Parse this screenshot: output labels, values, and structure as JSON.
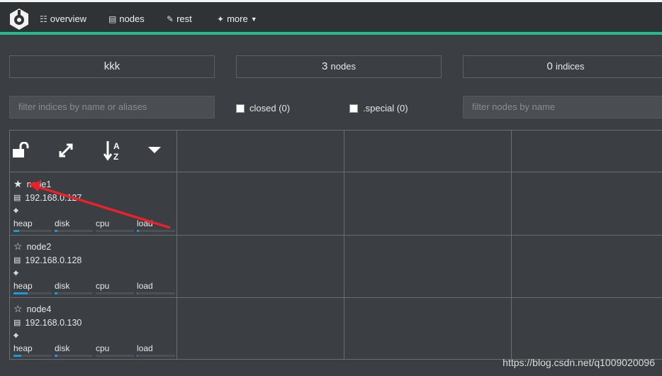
{
  "nav": {
    "overview": "overview",
    "nodes": "nodes",
    "rest": "rest",
    "more": "more"
  },
  "summary": {
    "cluster_name": "kkk",
    "nodes_count": "3",
    "nodes_label": "nodes",
    "indices_count": "0",
    "indices_label": "indices"
  },
  "filters": {
    "indices_placeholder": "filter indices by name or aliases",
    "closed": "closed (0)",
    "special": ".special (0)",
    "nodes_placeholder": "filter nodes by name"
  },
  "stat_labels": [
    "heap",
    "disk",
    "cpu",
    "load"
  ],
  "nodes": [
    {
      "name": "node1",
      "ip": "192.168.0.127",
      "master": true,
      "heap": 14,
      "disk": 7,
      "cpu": 0,
      "load": 5
    },
    {
      "name": "node2",
      "ip": "192.168.0.128",
      "master": false,
      "heap": 37,
      "disk": 7,
      "cpu": 0,
      "load": 1
    },
    {
      "name": "node4",
      "ip": "192.168.0.130",
      "master": false,
      "heap": 20,
      "disk": 7,
      "cpu": 0,
      "load": 1
    }
  ],
  "colors": {
    "accent": "#1fbd8c",
    "bar": "#1a9ad6",
    "annotation": "#e8222a"
  },
  "watermark": "https://blog.csdn.net/q1009020096"
}
